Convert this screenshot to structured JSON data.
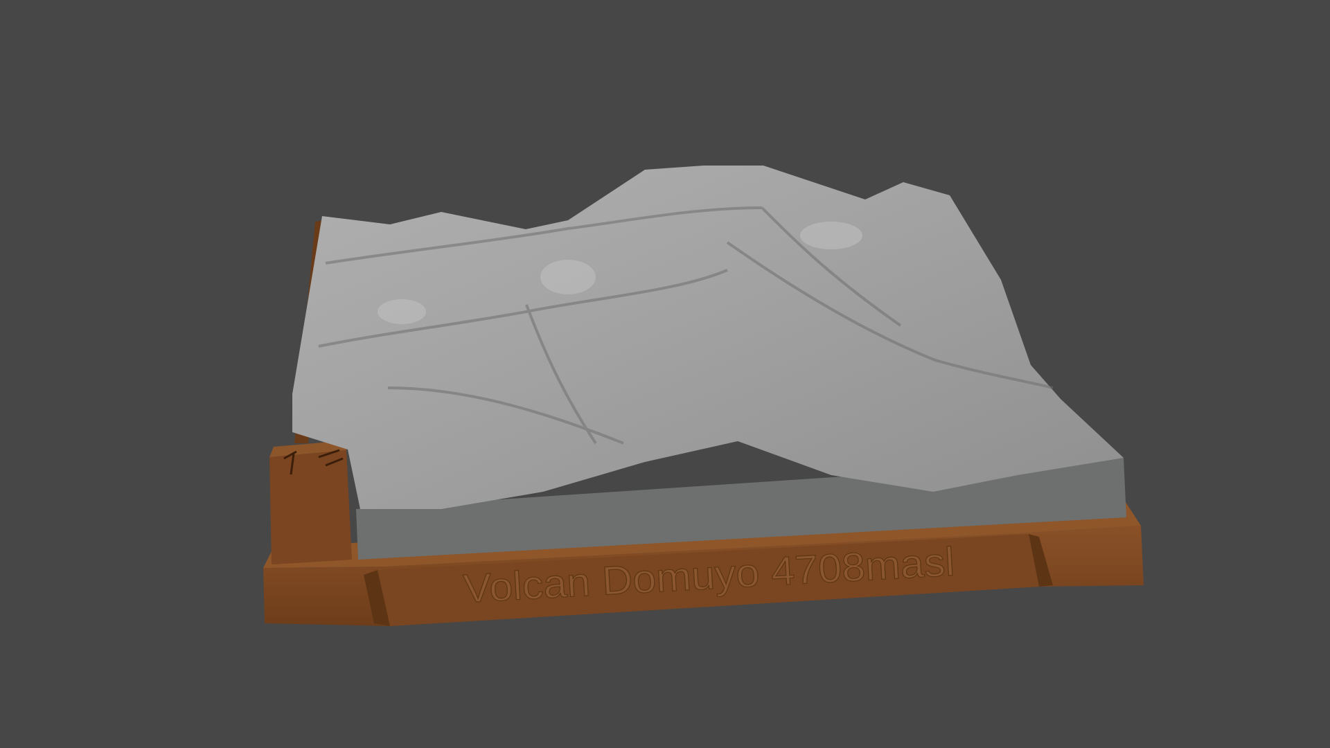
{
  "model": {
    "subject": "terrain relief model on wooden-colored base",
    "base_label": "Volcan Domuyo 4708masl",
    "colors": {
      "background": "#474747",
      "terrain": "#a4a4a4",
      "terrain_side": "#6e7070",
      "base": "#7a4620",
      "base_light": "#8f5528",
      "base_dark": "#5e3514"
    }
  }
}
